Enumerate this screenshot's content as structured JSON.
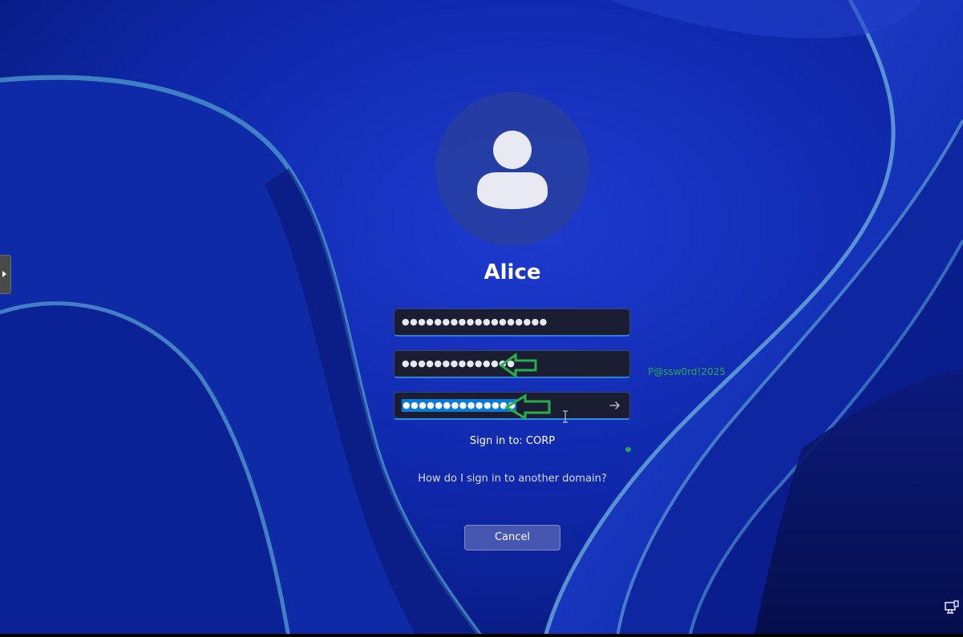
{
  "user": {
    "name": "Alice"
  },
  "fields": [
    {
      "masked_value": "●●●●●●●●●●●●●●●●●●",
      "selected": false
    },
    {
      "masked_value": "●●●●●●●●●●●●●●",
      "selected": false
    },
    {
      "masked_value": "●●●●●●●●●●●●●●",
      "selected": true
    }
  ],
  "annotation": {
    "text": "P@ssw0rd!2025",
    "color": "#2aa84a"
  },
  "signin_target": "Sign in to: CORP",
  "other_domain_link": "How do I sign in to another domain?",
  "cancel_label": "Cancel",
  "icons": {
    "avatar": "user-silhouette",
    "submit": "arrow-right",
    "side_tab": "triangle-right",
    "network": "network-monitor"
  },
  "colors": {
    "field_bg": "#1b1d33",
    "field_accent": "#2f7fd6",
    "selection": "#0a7ad6"
  }
}
